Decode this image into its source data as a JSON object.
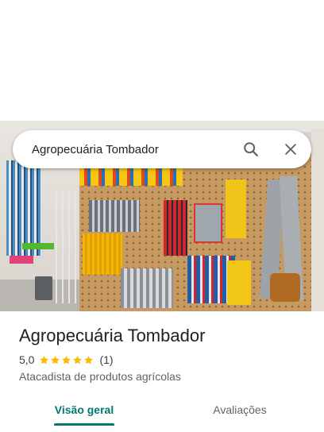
{
  "search": {
    "query": "Agropecuária Tombador",
    "search_icon": "search-icon",
    "close_icon": "close-icon"
  },
  "hero": {
    "photo": "store-interior-photo"
  },
  "place": {
    "name": "Agropecuária Tombador",
    "rating": "5,0",
    "rating_value": 5,
    "rating_max": 5,
    "review_count": "(1)",
    "category": "Atacadista de produtos agrícolas"
  },
  "tabs": [
    {
      "label": "Visão geral",
      "selected": true
    },
    {
      "label": "Avaliações",
      "selected": false
    }
  ],
  "colors": {
    "accent": "#01796f",
    "star": "#fbbc04",
    "text_primary": "#202124",
    "text_secondary": "#5f6368"
  }
}
